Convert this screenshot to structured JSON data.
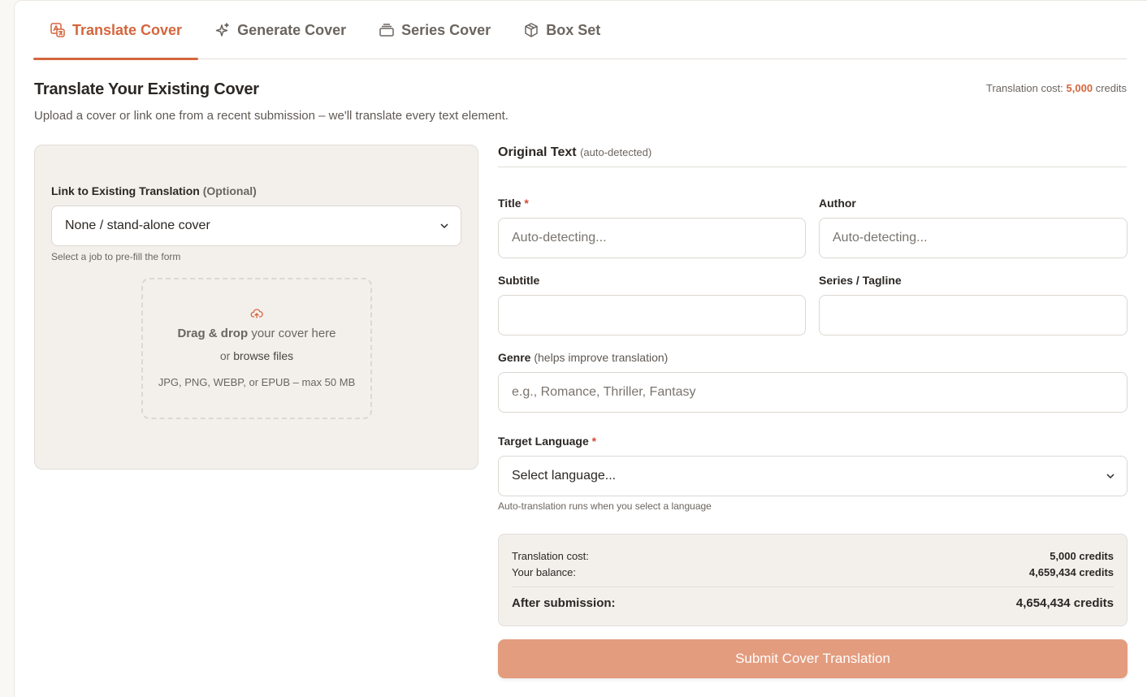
{
  "tabs": [
    {
      "label": "Translate Cover",
      "icon": "translate-icon"
    },
    {
      "label": "Generate Cover",
      "icon": "sparkle-icon"
    },
    {
      "label": "Series Cover",
      "icon": "stack-icon"
    },
    {
      "label": "Box Set",
      "icon": "box-icon"
    }
  ],
  "header": {
    "title": "Translate Your Existing Cover",
    "subtitle": "Upload a cover or link one from a recent submission – we'll translate every text element.",
    "cost_label": "Translation cost:",
    "cost_value": "5,000",
    "cost_unit": "credits"
  },
  "link": {
    "label": "Link to Existing Translation",
    "label_optional": "(Optional)",
    "selected": "None / stand-alone cover",
    "help": "Select a job to pre-fill the form"
  },
  "dropzone": {
    "bold": "Drag & drop",
    "rest": "your cover here",
    "or": "or",
    "browse": "browse files",
    "formats": "JPG, PNG, WEBP, or EPUB – max 50 MB"
  },
  "original": {
    "title": "Original Text",
    "note": "(auto-detected)"
  },
  "fields": {
    "title_label": "Title",
    "title_placeholder": "Auto-detecting...",
    "author_label": "Author",
    "author_placeholder": "Auto-detecting...",
    "subtitle_label": "Subtitle",
    "series_label": "Series / Tagline",
    "genre_label": "Genre",
    "genre_note": "(helps improve translation)",
    "genre_placeholder": "e.g., Romance, Thriller, Fantasy",
    "language_label": "Target Language",
    "language_selected": "Select language...",
    "language_help": "Auto-translation runs when you select a language",
    "required_mark": "*"
  },
  "summary": {
    "cost_label": "Translation cost:",
    "cost_value": "5,000 credits",
    "balance_label": "Your balance:",
    "balance_value": "4,659,434 credits",
    "after_label": "After submission:",
    "after_value": "4,654,434 credits"
  },
  "submit_label": "Submit Cover Translation",
  "colors": {
    "accent": "#d4663d",
    "button": "#e49c7e",
    "panel": "#f3f0ec"
  }
}
